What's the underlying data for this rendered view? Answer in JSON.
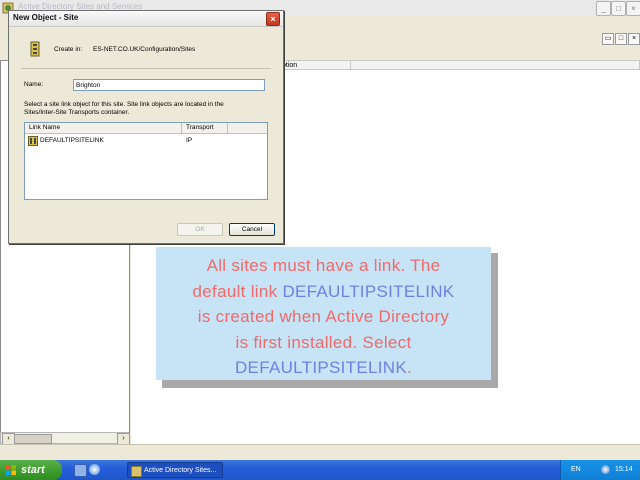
{
  "window": {
    "title": "Active Directory Sites and Services"
  },
  "right_pane": {
    "columns": [
      "",
      "ption",
      ""
    ]
  },
  "dialog": {
    "title": "New Object - Site",
    "create_in_label": "Create in:",
    "create_in_path": "ES-NET.CO.UK/Configuration/Sites",
    "name_label": "Name:",
    "name_value": "Brighton",
    "instruction_line1": "Select a site link object for this site. Site link objects are located in the",
    "instruction_line2": "Sites/Inter-Site Transports container.",
    "list": {
      "headers": [
        "Link Name",
        "Transport"
      ],
      "rows": [
        {
          "name": "DEFAULTIPSITELINK",
          "transport": "IP"
        }
      ]
    },
    "ok_label": "OK",
    "cancel_label": "Cancel"
  },
  "callout": {
    "p1": "All sites must have a link. The",
    "p2": "default link ",
    "p3": "DEFAULTIPSITELINK",
    "p4": "is created when Active Directory",
    "p5": "is first installed. Select",
    "p6": "DEFAULTIPSITELINK",
    "p7": ".",
    "colors": {
      "text": "#ef6a6a",
      "highlight": "#6f7fe6",
      "background": "#c7e4f6"
    }
  },
  "taskbar": {
    "start_label": "start",
    "task_item": "Active Directory Sites...",
    "language": "EN",
    "clock": "15:14"
  },
  "icons": [
    "app-icon",
    "minimize-icon",
    "maximize-icon",
    "close-icon",
    "site-icon",
    "sitelink-icon",
    "windows-logo-icon",
    "ie-icon",
    "explorer-icon"
  ]
}
